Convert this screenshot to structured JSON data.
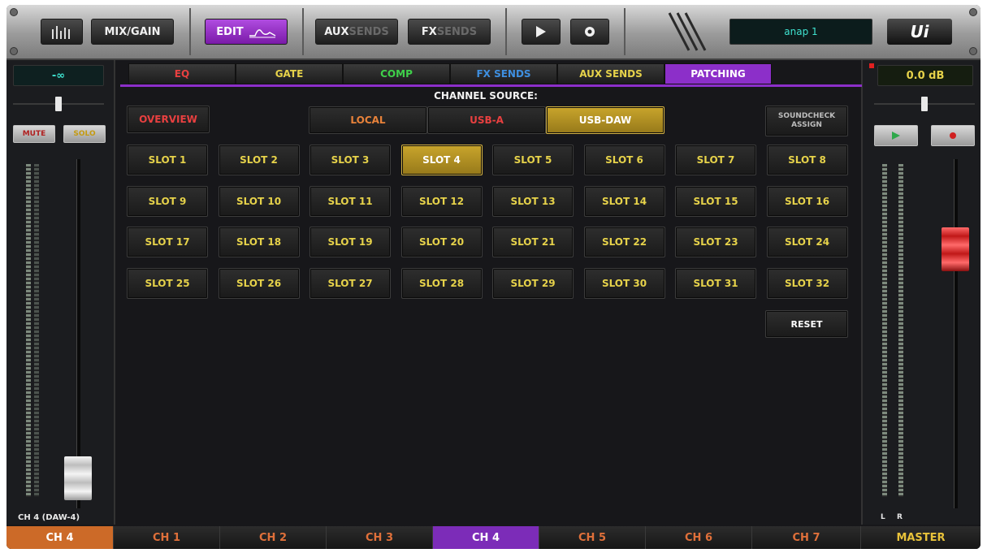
{
  "toolbar": {
    "mix_gain": "MIX/GAIN",
    "edit": "EDIT",
    "aux_sends_bright": "AUX",
    "aux_sends_dim": "SENDS",
    "fx_sends_bright": "FX",
    "fx_sends_dim": "SENDS",
    "snapshot_name": "anap 1",
    "logo": "Ui"
  },
  "left_strip": {
    "gain": "-∞",
    "mute": "MUTE",
    "solo": "SOLO",
    "channel_label": "CH 4 (DAW-4)"
  },
  "right_strip": {
    "gain": "0.0 dB",
    "left_label": "L",
    "right_label": "R"
  },
  "tabs": [
    {
      "label": "EQ",
      "color": "#e84040"
    },
    {
      "label": "GATE",
      "color": "#e6d24a"
    },
    {
      "label": "COMP",
      "color": "#3fd04a"
    },
    {
      "label": "FX SENDS",
      "color": "#3e8fe0"
    },
    {
      "label": "AUX SENDS",
      "color": "#e6d24a"
    },
    {
      "label": "PATCHING",
      "color": "#ffffff"
    }
  ],
  "overview": "OVERVIEW",
  "channel_source": {
    "title": "CHANNEL SOURCE:",
    "options": [
      "LOCAL",
      "USB-A",
      "USB-DAW"
    ],
    "selected": "USB-DAW"
  },
  "soundcheck": "SOUNDCHECK ASSIGN",
  "slots": [
    "SLOT 1",
    "SLOT 2",
    "SLOT 3",
    "SLOT 4",
    "SLOT 5",
    "SLOT 6",
    "SLOT 7",
    "SLOT 8",
    "SLOT 9",
    "SLOT 10",
    "SLOT 11",
    "SLOT 12",
    "SLOT 13",
    "SLOT 14",
    "SLOT 15",
    "SLOT 16",
    "SLOT 17",
    "SLOT 18",
    "SLOT 19",
    "SLOT 20",
    "SLOT 21",
    "SLOT 22",
    "SLOT 23",
    "SLOT 24",
    "SLOT 25",
    "SLOT 26",
    "SLOT 27",
    "SLOT 28",
    "SLOT 29",
    "SLOT 30",
    "SLOT 31",
    "SLOT 32"
  ],
  "selected_slot": "SLOT 4",
  "reset": "RESET",
  "channels": [
    "CH 1",
    "CH 2",
    "CH 3",
    "CH 4",
    "CH 5",
    "CH 6",
    "CH 7"
  ],
  "selected_channel": "CH 4",
  "current_channel": "CH 4",
  "master": "MASTER"
}
